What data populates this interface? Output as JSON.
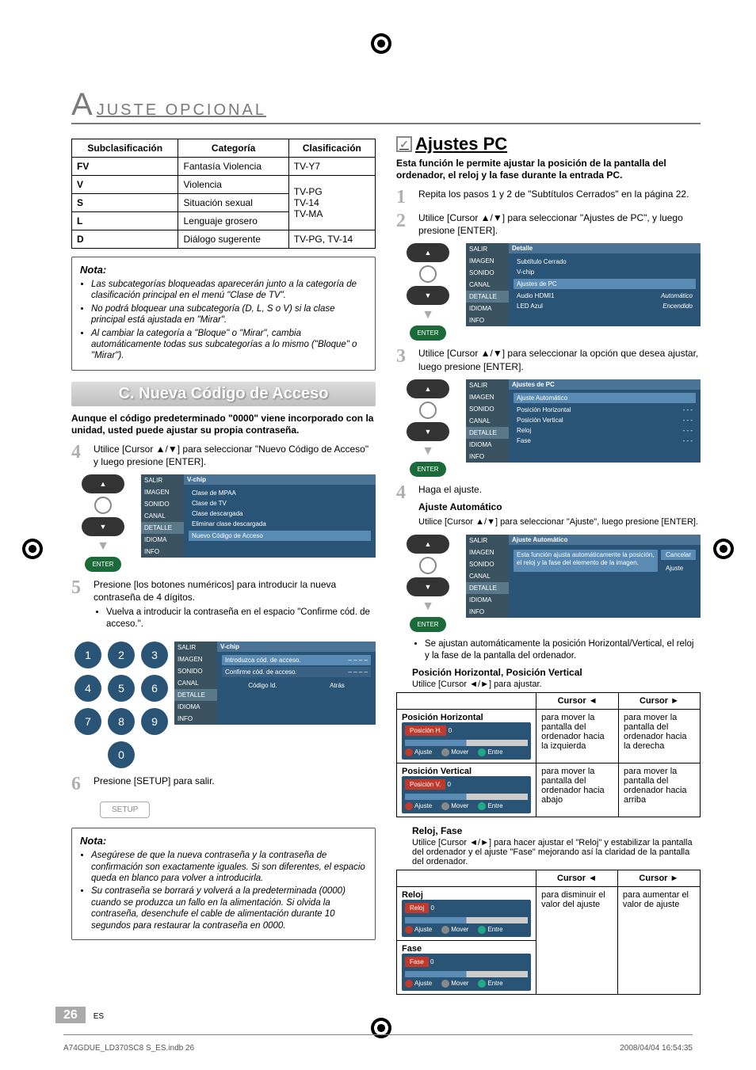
{
  "header": {
    "title": "JUSTE   OPCIONAL",
    "big": "A"
  },
  "classTable": {
    "headers": [
      "Subclasificación",
      "Categoría",
      "Clasificación"
    ],
    "rows": [
      {
        "c0": "FV",
        "c1": "Fantasía Violencia",
        "c2": "TV-Y7"
      },
      {
        "c0": "V",
        "c1": "Violencia",
        "c2": ""
      },
      {
        "c0": "S",
        "c1": "Situación sexual",
        "c2": "TV-PG\nTV-14\nTV-MA"
      },
      {
        "c0": "L",
        "c1": "Lenguaje grosero",
        "c2": ""
      },
      {
        "c0": "D",
        "c1": "Diálogo sugerente",
        "c2": "TV-PG, TV-14"
      }
    ]
  },
  "nota1": {
    "title": "Nota:",
    "items": [
      "Las subcategorías bloqueadas aparecerán junto a la categoría de clasificación principal en el menú \"Clase de TV\".",
      "No podrá bloquear una subcategoría (D, L, S o V) si la clase principal está ajustada en \"Mirar\".",
      "Al cambiar la categoría a \"Bloque\" o \"Mirar\", cambia automáticamente todas sus subcategorías a lo mismo (\"Bloque\" o \"Mirar\")."
    ]
  },
  "sectionC": {
    "band": "C.  Nueva Código de Acceso",
    "intro": "Aunque el código predeterminado \"0000\" viene incorporado con la unidad, usted puede ajustar su propia contraseña.",
    "step4": "Utilice [Cursor ▲/▼] para seleccionar \"Nuevo Código de Acceso\" y luego presione [ENTER].",
    "step5": "Presione [los botones numéricos] para introducir la nueva contraseña de 4 dígitos.",
    "step5sub": "Vuelva a introducir la contraseña en el espacio \"Confirme cód. de acceso.\".",
    "step6": "Presione [SETUP] para salir.",
    "tv4": {
      "hdr": "V-chip",
      "items": [
        "Clase de MPAA",
        "Clase de TV",
        "Clase descargada",
        "Eliminar clase descargada",
        "Nuevo Código de Acceso"
      ]
    },
    "tv5": {
      "hdr": "V-chip",
      "row1": "Introduzca cód. de acceso.",
      "row2": "Confirme cód. de acceso.",
      "btn1": "Código Id.",
      "btn2": "Atrás"
    }
  },
  "nota2": {
    "title": "Nota:",
    "items": [
      "Asegúrese de que la nueva contraseña y la contraseña de confirmación son exactamente iguales. Si son diferentes, el espacio queda en blanco para volver a introducirla.",
      "Su contraseña se borrará y volverá a la predeterminada (0000) cuando se produzca un fallo en la alimentación. Si olvida la contraseña, desenchufe el cable de alimentación durante 10 segundos para restaurar la contraseña en 0000."
    ]
  },
  "menuTabs": [
    "SALIR",
    "IMAGEN",
    "SONIDO",
    "CANAL",
    "DETALLE",
    "IDIOMA",
    "INFO"
  ],
  "remote": {
    "enter": "ENTER"
  },
  "pc": {
    "title": "Ajustes PC",
    "intro": "Esta función le permite ajustar la posición de la pantalla del ordenador, el reloj y la fase durante la entrada PC.",
    "step1": "Repita los pasos 1 y 2 de \"Subtítulos Cerrados\" en la página 22.",
    "step2": "Utilice [Cursor ▲/▼] para seleccionar \"Ajustes de PC\", y luego presione [ENTER].",
    "tv2": {
      "hdr": "Detalle",
      "rows": [
        [
          "Subtítulo Cerrado",
          ""
        ],
        [
          "V-chip",
          ""
        ],
        [
          "Ajustes de PC",
          ""
        ],
        [
          "Audio HDMI1",
          "Automático"
        ],
        [
          "LED Azul",
          "Encendido"
        ]
      ],
      "hl": 2
    },
    "step3": "Utilice [Cursor ▲/▼] para seleccionar la opción que desea ajustar, luego presione [ENTER].",
    "tv3": {
      "hdr": "Ajustes de PC",
      "rows": [
        [
          "Ajuste Automático",
          ""
        ],
        [
          "Posición Horizontal",
          "- - -"
        ],
        [
          "Posición Vertical",
          "- - -"
        ],
        [
          "Reloj",
          "- - -"
        ],
        [
          "Fase",
          "- - -"
        ]
      ],
      "hl": 0
    },
    "step4": "Haga el ajuste.",
    "autoTitle": "Ajuste Automático",
    "autoText": "Utilice [Cursor ▲/▼] para seleccionar \"Ajuste\", luego presione [ENTER].",
    "tv4": {
      "hdr": "Ajuste Automático",
      "note": "Esta función ajusta automáticamente la posición, el reloj y la fase del elemento de la imagen.",
      "btn1": "Cancelar",
      "btn2": "Ajuste"
    },
    "autoBullet": "Se ajustan automáticamente la posición Horizontal/Vertical, el reloj y la fase de la pantalla del ordenador.",
    "hvTitle": "Posición Horizontal, Posición Vertical",
    "hvText": "Utilice [Cursor ◄/►] para ajustar.",
    "hvTable": {
      "headers": [
        "",
        "Cursor ◄",
        "Cursor ►"
      ],
      "rows": [
        {
          "label": "Posición Horizontal",
          "panel": "Posición H.",
          "l": "para mover la pantalla del ordenador hacia la izquierda",
          "r": "para mover la pantalla del ordenador hacia la derecha"
        },
        {
          "label": "Posición Vertical",
          "panel": "Posición V.",
          "l": "para mover la pantalla del ordenador hacia abajo",
          "r": "para mover la pantalla del ordenador hacia arriba"
        }
      ]
    },
    "rfTitle": "Reloj, Fase",
    "rfText": "Utilice [Cursor ◄/►] para hacer ajustar el \"Reloj\" y estabilizar la pantalla del ordenador y el ajuste \"Fase\" mejorando así la claridad de la pantalla del ordenador.",
    "rfTable": {
      "headers": [
        "",
        "Cursor ◄",
        "Cursor ►"
      ],
      "rows": [
        {
          "label": "Reloj",
          "panel": "Reloj"
        },
        {
          "label": "Fase",
          "panel": "Fase"
        }
      ],
      "l": "para disminuir el valor del ajuste",
      "r": "para aumentar el valor de ajuste"
    },
    "sliderBtns": {
      "a": "Ajuste",
      "b": "Mover",
      "c": "Entre"
    }
  },
  "page": {
    "num": "26",
    "es": "ES"
  },
  "footer": {
    "l": "A74GDUE_LD370SC8 S_ES.indb   26",
    "r": "2008/04/04   16:54:35"
  },
  "setup": "SETUP"
}
